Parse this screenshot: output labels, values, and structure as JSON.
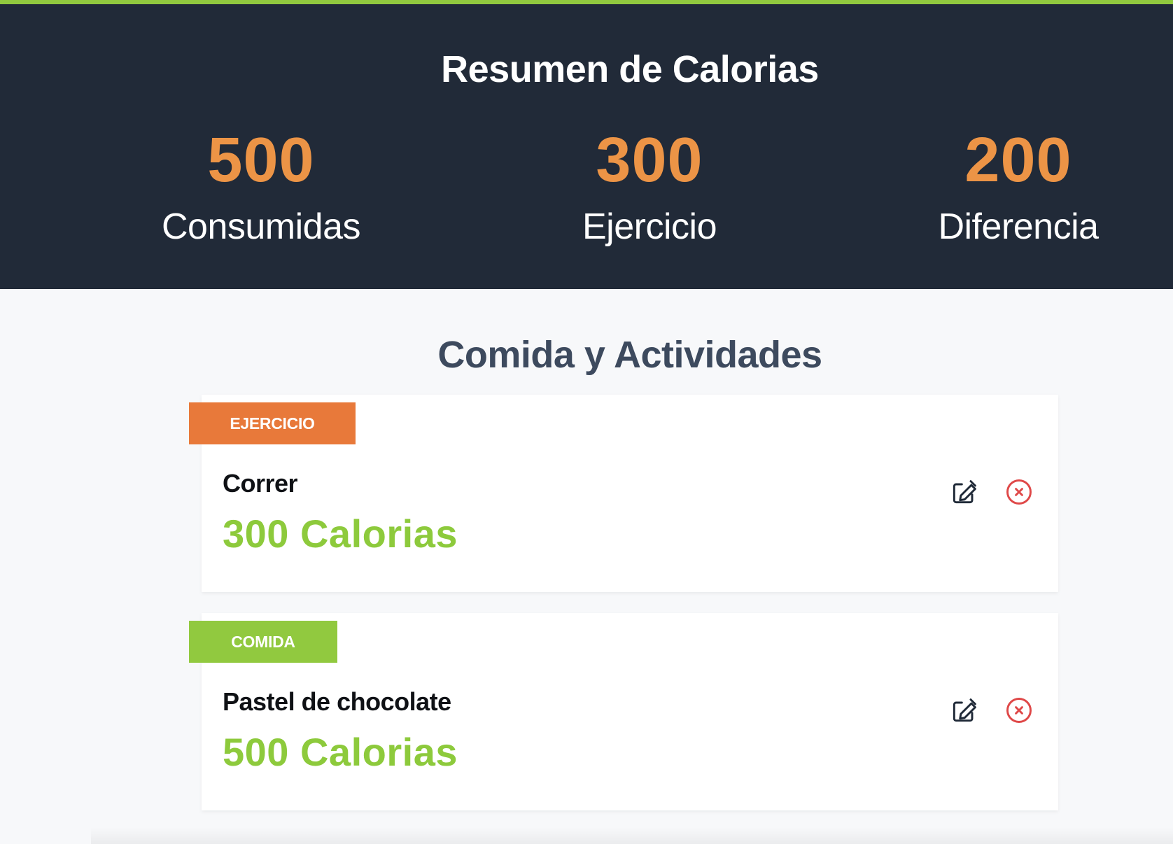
{
  "colors": {
    "accent_green": "#91c93f",
    "header_bg": "#212a38",
    "orange": "#ec9446",
    "exercise_badge": "#e8793a",
    "calories_green": "#8dca3c",
    "delete_red": "#df4848"
  },
  "summary": {
    "title": "Resumen de Calorias",
    "stats": [
      {
        "value": "500",
        "label": "Consumidas"
      },
      {
        "value": "300",
        "label": "Ejercicio"
      },
      {
        "value": "200",
        "label": "Diferencia"
      }
    ]
  },
  "activities": {
    "title": "Comida y Actividades",
    "items": [
      {
        "category": "EJERCICIO",
        "name": "Correr",
        "calories": "300 Calorias",
        "edit_icon": "pencil-square-icon",
        "delete_icon": "x-circle-icon"
      },
      {
        "category": "COMIDA",
        "name": "Pastel de chocolate",
        "calories": "500 Calorias",
        "edit_icon": "pencil-square-icon",
        "delete_icon": "x-circle-icon"
      }
    ]
  }
}
